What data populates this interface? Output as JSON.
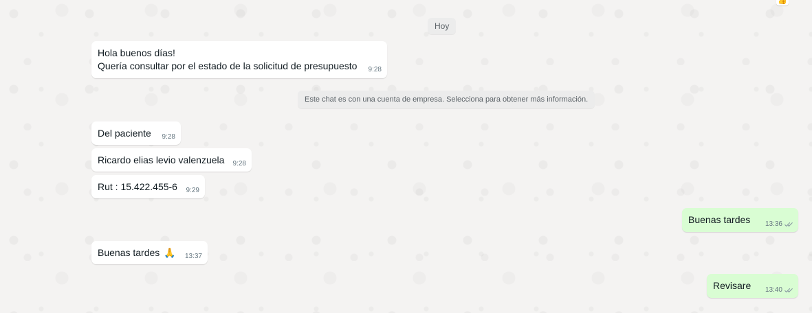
{
  "chat": {
    "date_label": "Hoy",
    "system_notice": "Este chat es con una cuenta de empresa. Selecciona para obtener más información.",
    "corner_icon": "thumbs-up-icon",
    "messages": [
      {
        "direction": "incoming",
        "lines": [
          "Hola buenos días!",
          "Quería consultar por el estado de la solicitud de presupuesto"
        ],
        "time": "9:28"
      },
      {
        "direction": "incoming",
        "text": "Del paciente",
        "time": "9:28"
      },
      {
        "direction": "incoming",
        "text": "Ricardo elias levio valenzuela",
        "time": "9:28"
      },
      {
        "direction": "incoming",
        "text": "Rut : 15.422.455-6",
        "time": "9:29"
      },
      {
        "direction": "incoming",
        "text": "Buenas tardes",
        "emoji": "🙏",
        "time": "13:37"
      },
      {
        "direction": "outgoing",
        "text": "Buenas tardes",
        "time": "13:36",
        "status": "read-double-check-icon"
      },
      {
        "direction": "outgoing",
        "text": "Revisare",
        "time": "13:40",
        "status": "read-double-check-icon"
      }
    ]
  },
  "colors": {
    "background": "#f4f3f2",
    "incoming_bubble": "#ffffff",
    "outgoing_bubble": "#d9fdd3",
    "timestamp": "#667781",
    "pill_bg": "#ececec"
  }
}
